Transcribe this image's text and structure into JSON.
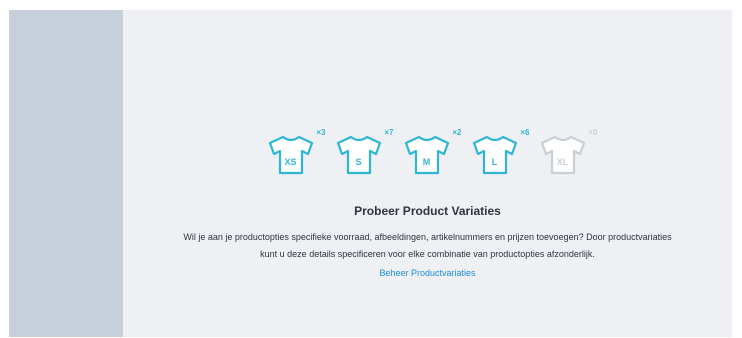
{
  "variations": [
    {
      "size": "XS",
      "count": "×3",
      "active": true
    },
    {
      "size": "S",
      "count": "×7",
      "active": true
    },
    {
      "size": "M",
      "count": "×2",
      "active": true
    },
    {
      "size": "L",
      "count": "×6",
      "active": true
    },
    {
      "size": "XL",
      "count": "×0",
      "active": false
    }
  ],
  "icon": "tshirt-icon",
  "colors": {
    "accent": "#2fb6d6",
    "inactive": "#c9ced4",
    "link": "#1f8ce0",
    "sidebar": "#c7d0da",
    "panel": "#eef0f3"
  },
  "promo": {
    "title": "Probeer Product Variaties",
    "description": "Wil je aan je productopties specifieke voorraad, afbeeldingen, artikelnummers en prijzen toevoegen? Door productvariaties kunt u deze details specificeren voor elke combinatie van productopties afzonderlijk.",
    "link_label": "Beheer Productvariaties"
  }
}
